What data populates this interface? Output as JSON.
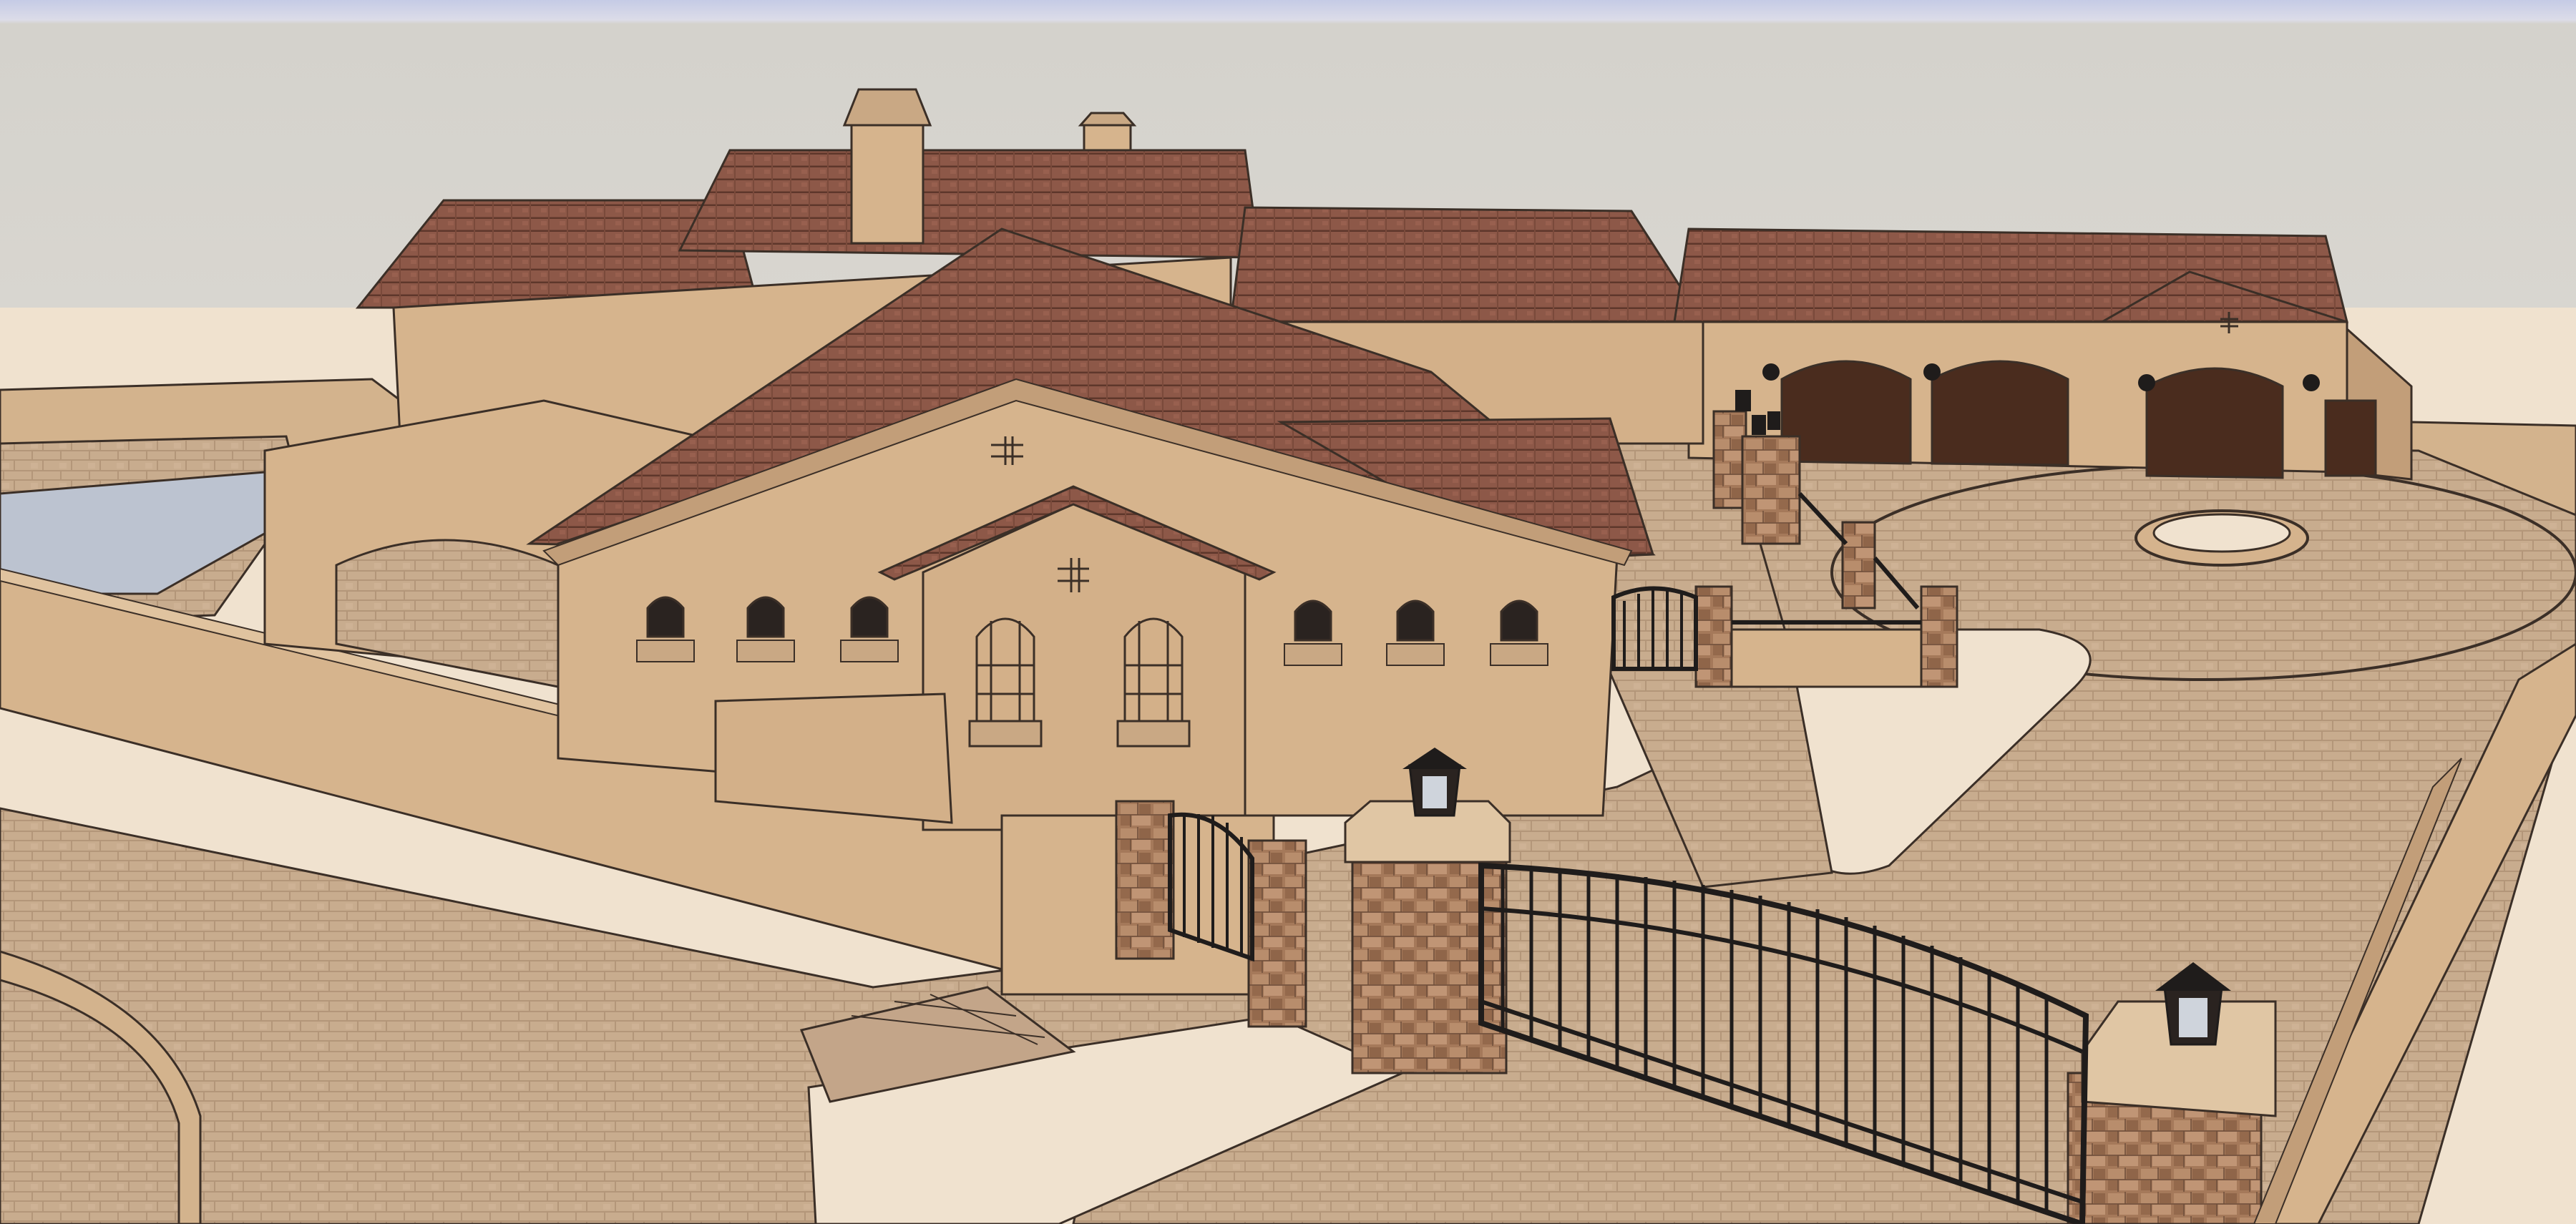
{
  "scene": {
    "kind": "3d-architectural-model-render",
    "subject": "mediterranean-villa-with-gated-motor-court",
    "colors": {
      "sky_top": "#c6cce6",
      "sky": "#d6d3cd",
      "ground": "#f1e1cc",
      "stucco": "#d6b48d",
      "stucco_shade": "#c29e79",
      "roof_tile": "#8d5848",
      "roof_tile_dark": "#6f4234",
      "paver": "#c9ad90",
      "paver_line": "#b59a7e",
      "stone": "#a27a5b",
      "garage_door": "#4a2c1e",
      "iron": "#1f1c1b",
      "pool_water": "#bcc3d0",
      "line": "#3b2f27"
    },
    "objects": {
      "gates": 2,
      "garage_doors": 3,
      "arched_windows": 6,
      "tall_windows": 2,
      "lanterns": 2,
      "chimneys": 2,
      "fire_pit": 1
    }
  }
}
